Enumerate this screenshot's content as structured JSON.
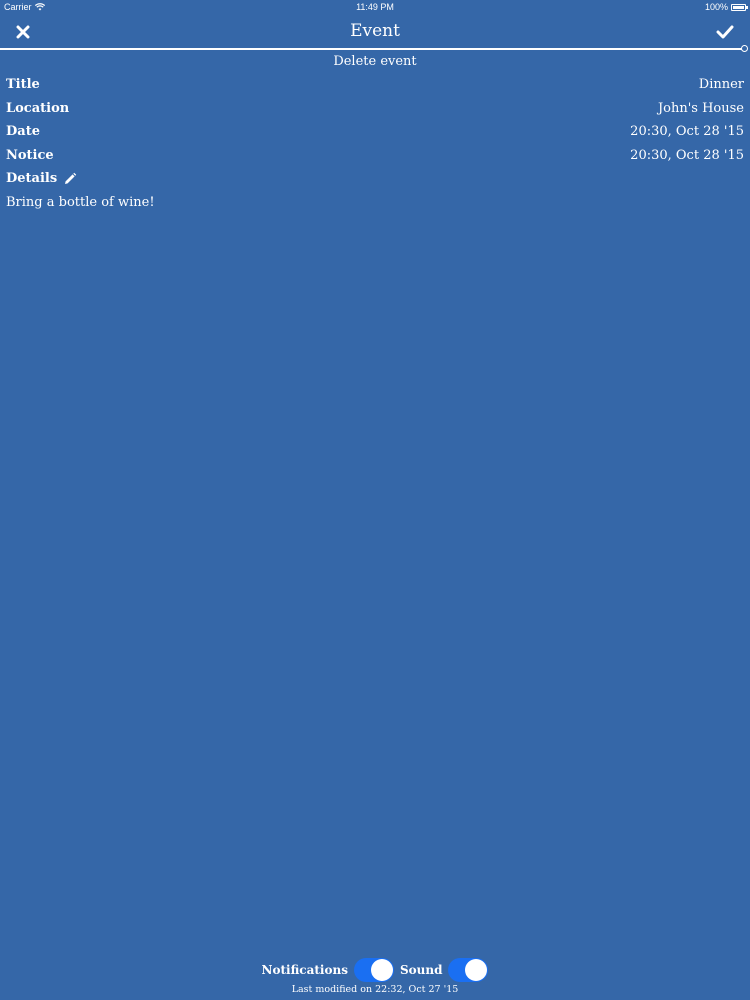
{
  "status_bar": {
    "carrier": "Carrier",
    "time": "11:49 PM",
    "battery": "100%"
  },
  "nav": {
    "title": "Event",
    "close_icon": "close-icon",
    "done_icon": "checkmark-icon"
  },
  "delete_label": "Delete event",
  "fields": {
    "title_label": "Title",
    "title_value": "Dinner",
    "location_label": "Location",
    "location_value": "John's House",
    "date_label": "Date",
    "date_value": "20:30, Oct 28 '15",
    "notice_label": "Notice",
    "notice_value": "20:30, Oct 28 '15",
    "details_label": "Details",
    "details_icon": "pencil-icon",
    "details_text": "Bring a bottle of wine!"
  },
  "footer": {
    "notifications_label": "Notifications",
    "notifications_on": true,
    "sound_label": "Sound",
    "sound_on": true,
    "last_modified": "Last modified on 22:32, Oct 27 '15"
  },
  "colors": {
    "background": "#3567a8",
    "switch_on": "#1a6ff2",
    "text": "#ffffff"
  }
}
